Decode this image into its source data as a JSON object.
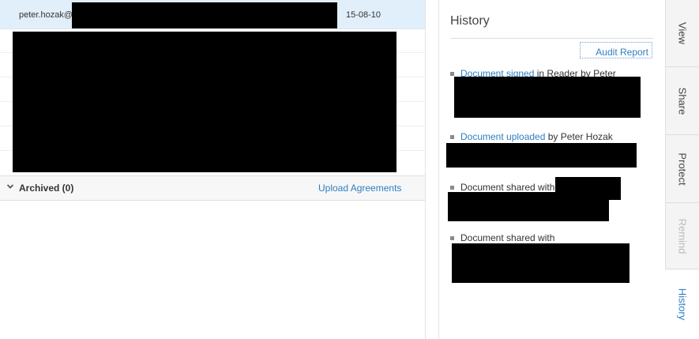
{
  "agreements": {
    "selected_row": {
      "email": "peter.hozak@",
      "date": "15-08-10"
    },
    "archived_label": "Archived (0)",
    "upload_link": "Upload Agreements"
  },
  "history": {
    "title": "History",
    "audit_report": "Audit Report",
    "events": [
      {
        "link": "Document signed",
        "text": " in Reader by Peter"
      },
      {
        "link": "Document uploaded",
        "text": " by Peter Hozak"
      },
      {
        "link": "",
        "text": "Document shared with"
      },
      {
        "link": "",
        "text": "Document shared with"
      }
    ]
  },
  "tabs": [
    {
      "label": "View",
      "state": "normal"
    },
    {
      "label": "Share",
      "state": "normal"
    },
    {
      "label": "Protect",
      "state": "normal"
    },
    {
      "label": "Remind",
      "state": "disabled"
    },
    {
      "label": "History",
      "state": "active"
    }
  ],
  "colors": {
    "link": "#2d7fc1",
    "selected_row": "#e1effb",
    "disabled_tab": "#bbbbbb",
    "redaction": "#000000"
  }
}
